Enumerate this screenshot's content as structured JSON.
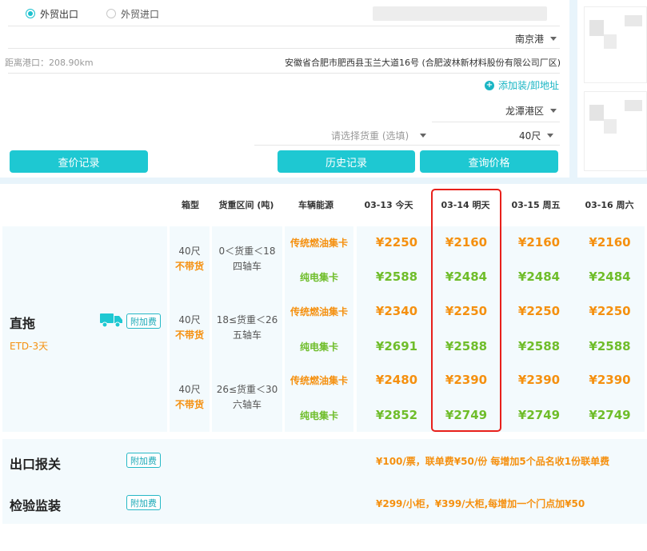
{
  "form": {
    "radio_export": "外贸出口",
    "radio_import": "外贸进口",
    "port": "南京港",
    "distance": "距离港口：208.90km",
    "address": "安徽省合肥市肥西县玉兰大道16号 (合肥波林新材料股份有限公司厂区)",
    "add_address": "添加装/卸地址",
    "port_area": "龙潭港区",
    "cargo_weight_placeholder": "请选择货重 (选填)",
    "container_size": "40尺",
    "btn_price_log": "查价记录",
    "btn_history": "历史记录",
    "btn_query": "查询价格"
  },
  "table": {
    "headers": [
      "箱型",
      "货重区间 (吨)",
      "车辆能源",
      "03-13 今天",
      "03-14 明天",
      "03-15 周五",
      "03-16 周六"
    ],
    "service": {
      "name": "直拖",
      "etd": "ETD-3天",
      "surcharge": "附加费"
    },
    "groups": [
      {
        "box": "40尺",
        "box_note": "不带货",
        "weight": "0＜货重＜18",
        "axle": "四轴车",
        "rows": [
          {
            "energy": "传统燃油集卡",
            "prices": [
              "¥2250",
              "¥2160",
              "¥2160",
              "¥2160"
            ]
          },
          {
            "energy": "纯电集卡",
            "prices": [
              "¥2588",
              "¥2484",
              "¥2484",
              "¥2484"
            ]
          }
        ]
      },
      {
        "box": "40尺",
        "box_note": "不带货",
        "weight": "18≤货重＜26",
        "axle": "五轴车",
        "rows": [
          {
            "energy": "传统燃油集卡",
            "prices": [
              "¥2340",
              "¥2250",
              "¥2250",
              "¥2250"
            ]
          },
          {
            "energy": "纯电集卡",
            "prices": [
              "¥2691",
              "¥2588",
              "¥2588",
              "¥2588"
            ]
          }
        ]
      },
      {
        "box": "40尺",
        "box_note": "不带货",
        "weight": "26≤货重＜30",
        "axle": "六轴车",
        "rows": [
          {
            "energy": "传统燃油集卡",
            "prices": [
              "¥2480",
              "¥2390",
              "¥2390",
              "¥2390"
            ]
          },
          {
            "energy": "纯电集卡",
            "prices": [
              "¥2852",
              "¥2749",
              "¥2749",
              "¥2749"
            ]
          }
        ]
      }
    ]
  },
  "extras": [
    {
      "name": "出口报关",
      "surcharge": "附加费",
      "note": "¥100/票，联单费¥50/份  每增加5个品名收1份联单费"
    },
    {
      "name": "检验监装",
      "surcharge": "附加费",
      "note": "¥299/小柜，¥399/大柜,每增加一个门点加¥50"
    }
  ],
  "colors": {
    "accent": "#1ec8d2",
    "fuel": "#f5900f",
    "electric": "#6fbd2a",
    "highlight": "#e8201b"
  }
}
